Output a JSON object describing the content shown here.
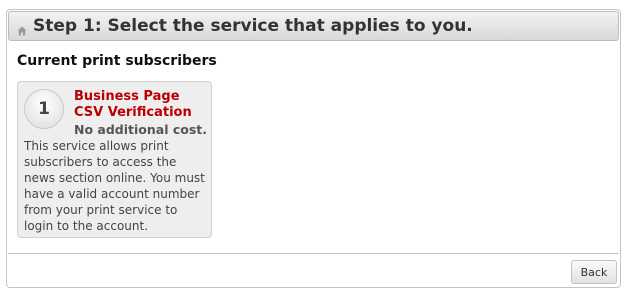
{
  "header": {
    "icon": "home-icon",
    "title": "Step 1: Select the service that applies to you."
  },
  "section": {
    "heading": "Current print subscribers"
  },
  "services": [
    {
      "number": "1",
      "name": "Business Page CSV Verification",
      "cost": "No additional cost.",
      "description": "This service allows print subscribers to access the news section online. You must have a valid account number from your print service to login to the account."
    }
  ],
  "colors": {
    "service_name": "#b80000",
    "card_background": "#eeeeee"
  },
  "footer": {
    "back_label": "Back"
  }
}
